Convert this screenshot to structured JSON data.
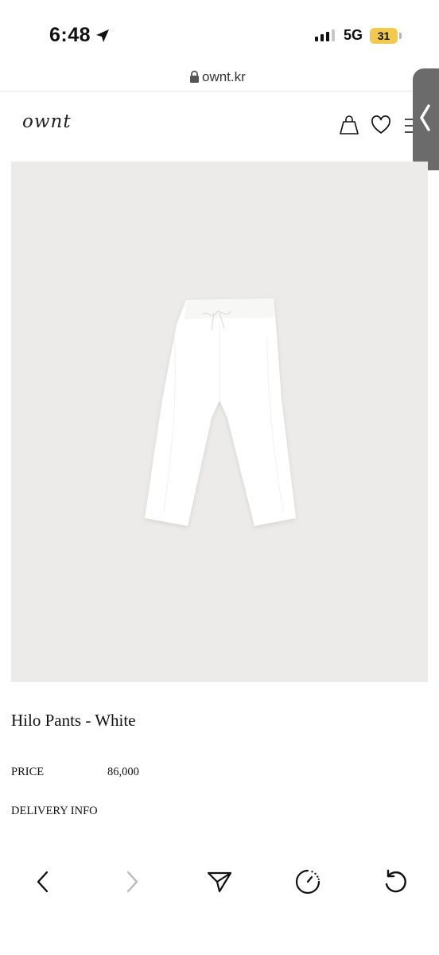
{
  "status_bar": {
    "time": "6:48",
    "network": "5G",
    "battery": "31",
    "icons": [
      "location-arrow-icon",
      "signal-bars-icon",
      "battery-icon"
    ]
  },
  "browser": {
    "url": "ownt.kr",
    "url_icon": "lock-icon",
    "toolbar_icons": [
      "back-icon",
      "forward-icon",
      "share-icon",
      "timer-icon",
      "reload-icon"
    ]
  },
  "site": {
    "logo": "ownt",
    "header_icons": [
      "shopping-bag-icon",
      "heart-icon",
      "menu-icon"
    ],
    "side_tab_icon": "chevron-left-icon"
  },
  "product": {
    "title": "Hilo Pants - White",
    "price_label": "PRICE",
    "price": "86,000",
    "delivery_label": "DELIVERY INFO",
    "image_background": "#ecebe9",
    "garment_color": "#ffffff"
  }
}
